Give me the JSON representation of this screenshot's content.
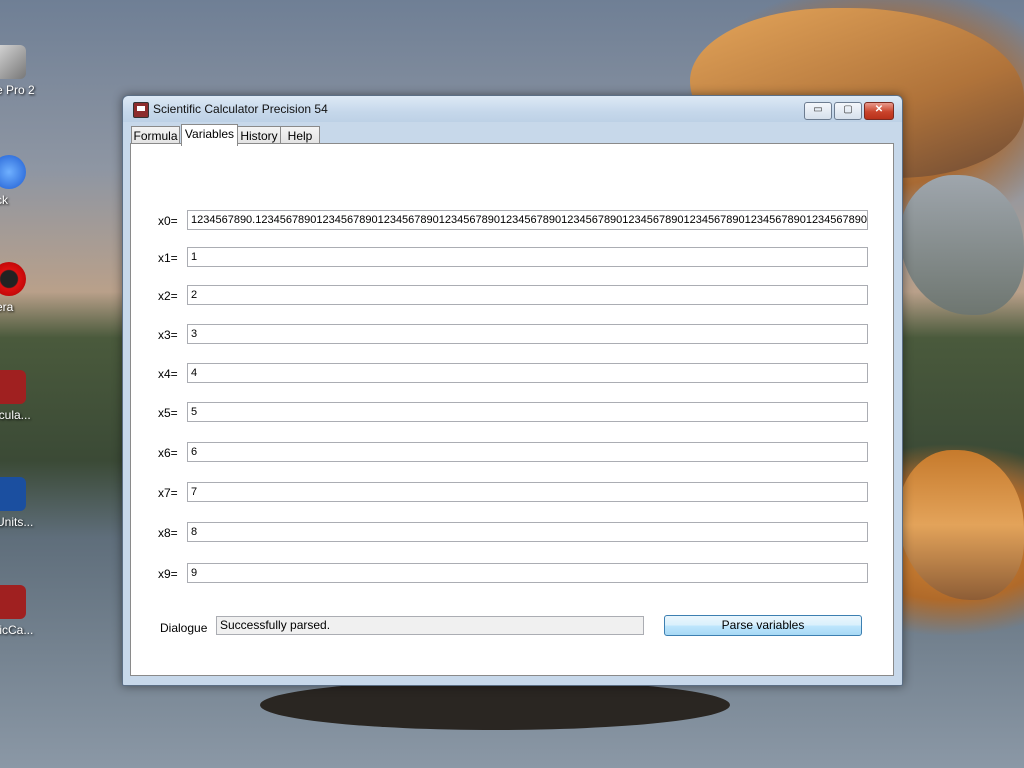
{
  "desktop": {
    "icons": [
      {
        "label": "e Pro 2"
      },
      {
        "label": "ck"
      },
      {
        "label": "era"
      },
      {
        "label": "lcula..."
      },
      {
        "label": "Units..."
      },
      {
        "label": "ficCa..."
      }
    ]
  },
  "window": {
    "title": "Scientific Calculator Precision 54",
    "controls": {
      "minimize": "▭",
      "maximize": "▢",
      "close": "✕"
    }
  },
  "tabs": [
    {
      "label": "Formula"
    },
    {
      "label": "Variables"
    },
    {
      "label": "History"
    },
    {
      "label": "Help"
    }
  ],
  "variables": [
    {
      "label": "x0=",
      "value": "1234567890.1234567890123456789012345678901234567890123456789012345678901234567890123456789012345678901234567890"
    },
    {
      "label": "x1=",
      "value": "1"
    },
    {
      "label": "x2=",
      "value": "2"
    },
    {
      "label": "x3=",
      "value": "3"
    },
    {
      "label": "x4=",
      "value": "4"
    },
    {
      "label": "x5=",
      "value": "5"
    },
    {
      "label": "x6=",
      "value": "6"
    },
    {
      "label": "x7=",
      "value": "7"
    },
    {
      "label": "x8=",
      "value": "8"
    },
    {
      "label": "x9=",
      "value": "9"
    }
  ],
  "dialogue": {
    "label": "Dialogue",
    "message": "Successfully parsed."
  },
  "parse_button": {
    "label": "Parse variables"
  }
}
